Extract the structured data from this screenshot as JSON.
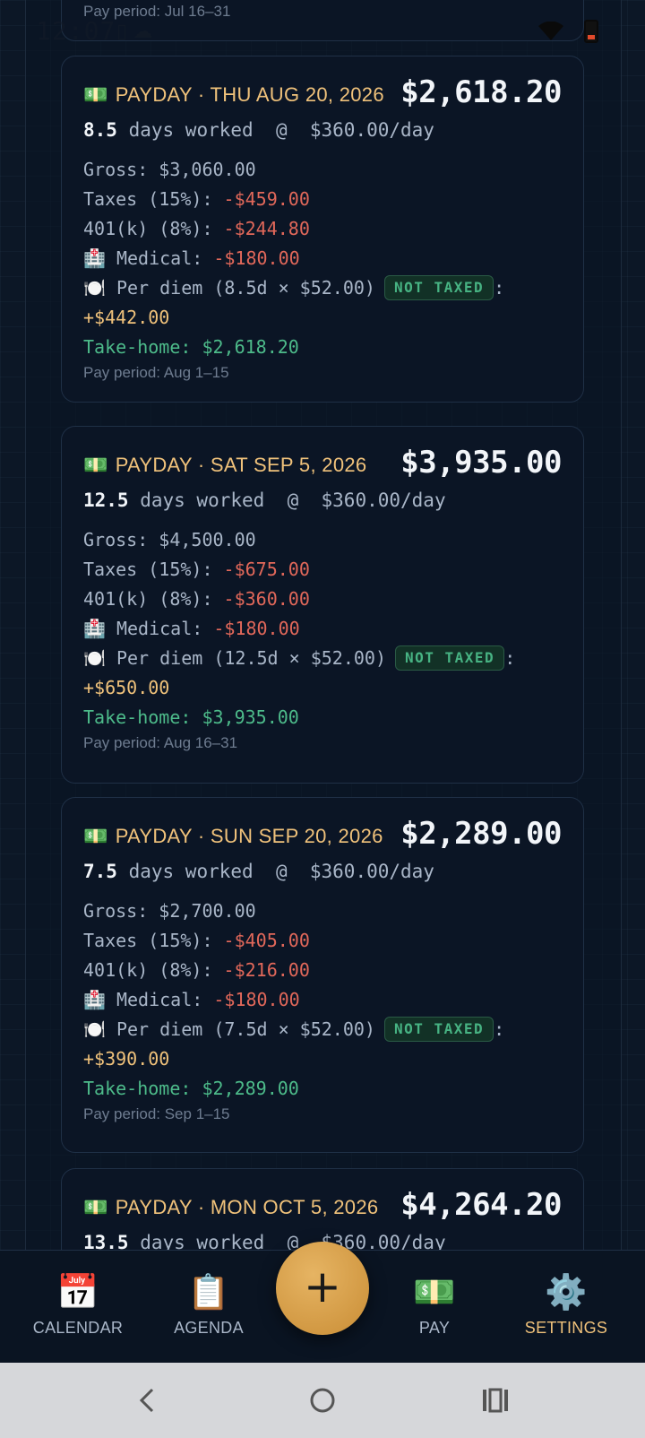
{
  "status_bar": {
    "time": "12:07",
    "icons": [
      "sim-icon",
      "cloud-icon"
    ],
    "right_icons": [
      "wifi-icon",
      "battery-icon"
    ]
  },
  "previous_card": {
    "period": "Pay period: Jul 16–31"
  },
  "paydays": [
    {
      "title": "PAYDAY · THU AUG 20, 2026",
      "amount": "$2,618.20",
      "days": "8.5",
      "days_suffix": " days worked  @  $360.00/day",
      "gross": "Gross: $3,060.00",
      "taxes_label": "Taxes (15%): ",
      "taxes_value": "-$459.00",
      "k401_label": "401(k) (8%): ",
      "k401_value": "-$244.80",
      "medical_label": "Medical: ",
      "medical_value": "-$180.00",
      "perdiem_label": "Per diem (8.5d × $52.00)",
      "perdiem_badge": "NOT TAXED",
      "perdiem_value": "+$442.00",
      "take_home": "Take-home: $2,618.20",
      "period": "Pay period: Aug 1–15"
    },
    {
      "title": "PAYDAY · SAT SEP 5, 2026",
      "amount": "$3,935.00",
      "days": "12.5",
      "days_suffix": " days worked  @  $360.00/day",
      "gross": "Gross: $4,500.00",
      "taxes_label": "Taxes (15%): ",
      "taxes_value": "-$675.00",
      "k401_label": "401(k) (8%): ",
      "k401_value": "-$360.00",
      "medical_label": "Medical: ",
      "medical_value": "-$180.00",
      "perdiem_label": "Per diem (12.5d × $52.00)",
      "perdiem_badge": "NOT TAXED",
      "perdiem_value": "+$650.00",
      "take_home": "Take-home: $3,935.00",
      "period": "Pay period: Aug 16–31"
    },
    {
      "title": "PAYDAY · SUN SEP 20, 2026",
      "amount": "$2,289.00",
      "days": "7.5",
      "days_suffix": " days worked  @  $360.00/day",
      "gross": "Gross: $2,700.00",
      "taxes_label": "Taxes (15%): ",
      "taxes_value": "-$405.00",
      "k401_label": "401(k) (8%): ",
      "k401_value": "-$216.00",
      "medical_label": "Medical: ",
      "medical_value": "-$180.00",
      "perdiem_label": "Per diem (7.5d × $52.00)",
      "perdiem_badge": "NOT TAXED",
      "perdiem_value": "+$390.00",
      "take_home": "Take-home: $2,289.00",
      "period": "Pay period: Sep 1–15"
    },
    {
      "title": "PAYDAY · MON OCT 5, 2026",
      "amount": "$4,264.20",
      "days": "13.5",
      "days_suffix": " days worked  @  $360.00/day"
    }
  ],
  "nav": {
    "items": [
      {
        "label": "CALENDAR",
        "icon": "calendar-icon",
        "glyph": "📅"
      },
      {
        "label": "AGENDA",
        "icon": "clipboard-icon",
        "glyph": "📋"
      },
      {
        "label": "PAY",
        "icon": "money-icon",
        "glyph": "💵"
      },
      {
        "label": "SETTINGS",
        "icon": "gear-icon",
        "glyph": "⚙️"
      }
    ],
    "fab_label": "+",
    "active": "SETTINGS"
  },
  "colors": {
    "background": "#0c1726",
    "card": "#0b1525",
    "accent_gold": "#f0c27b",
    "negative": "#e2685a",
    "positive_green": "#4dbb8a"
  }
}
